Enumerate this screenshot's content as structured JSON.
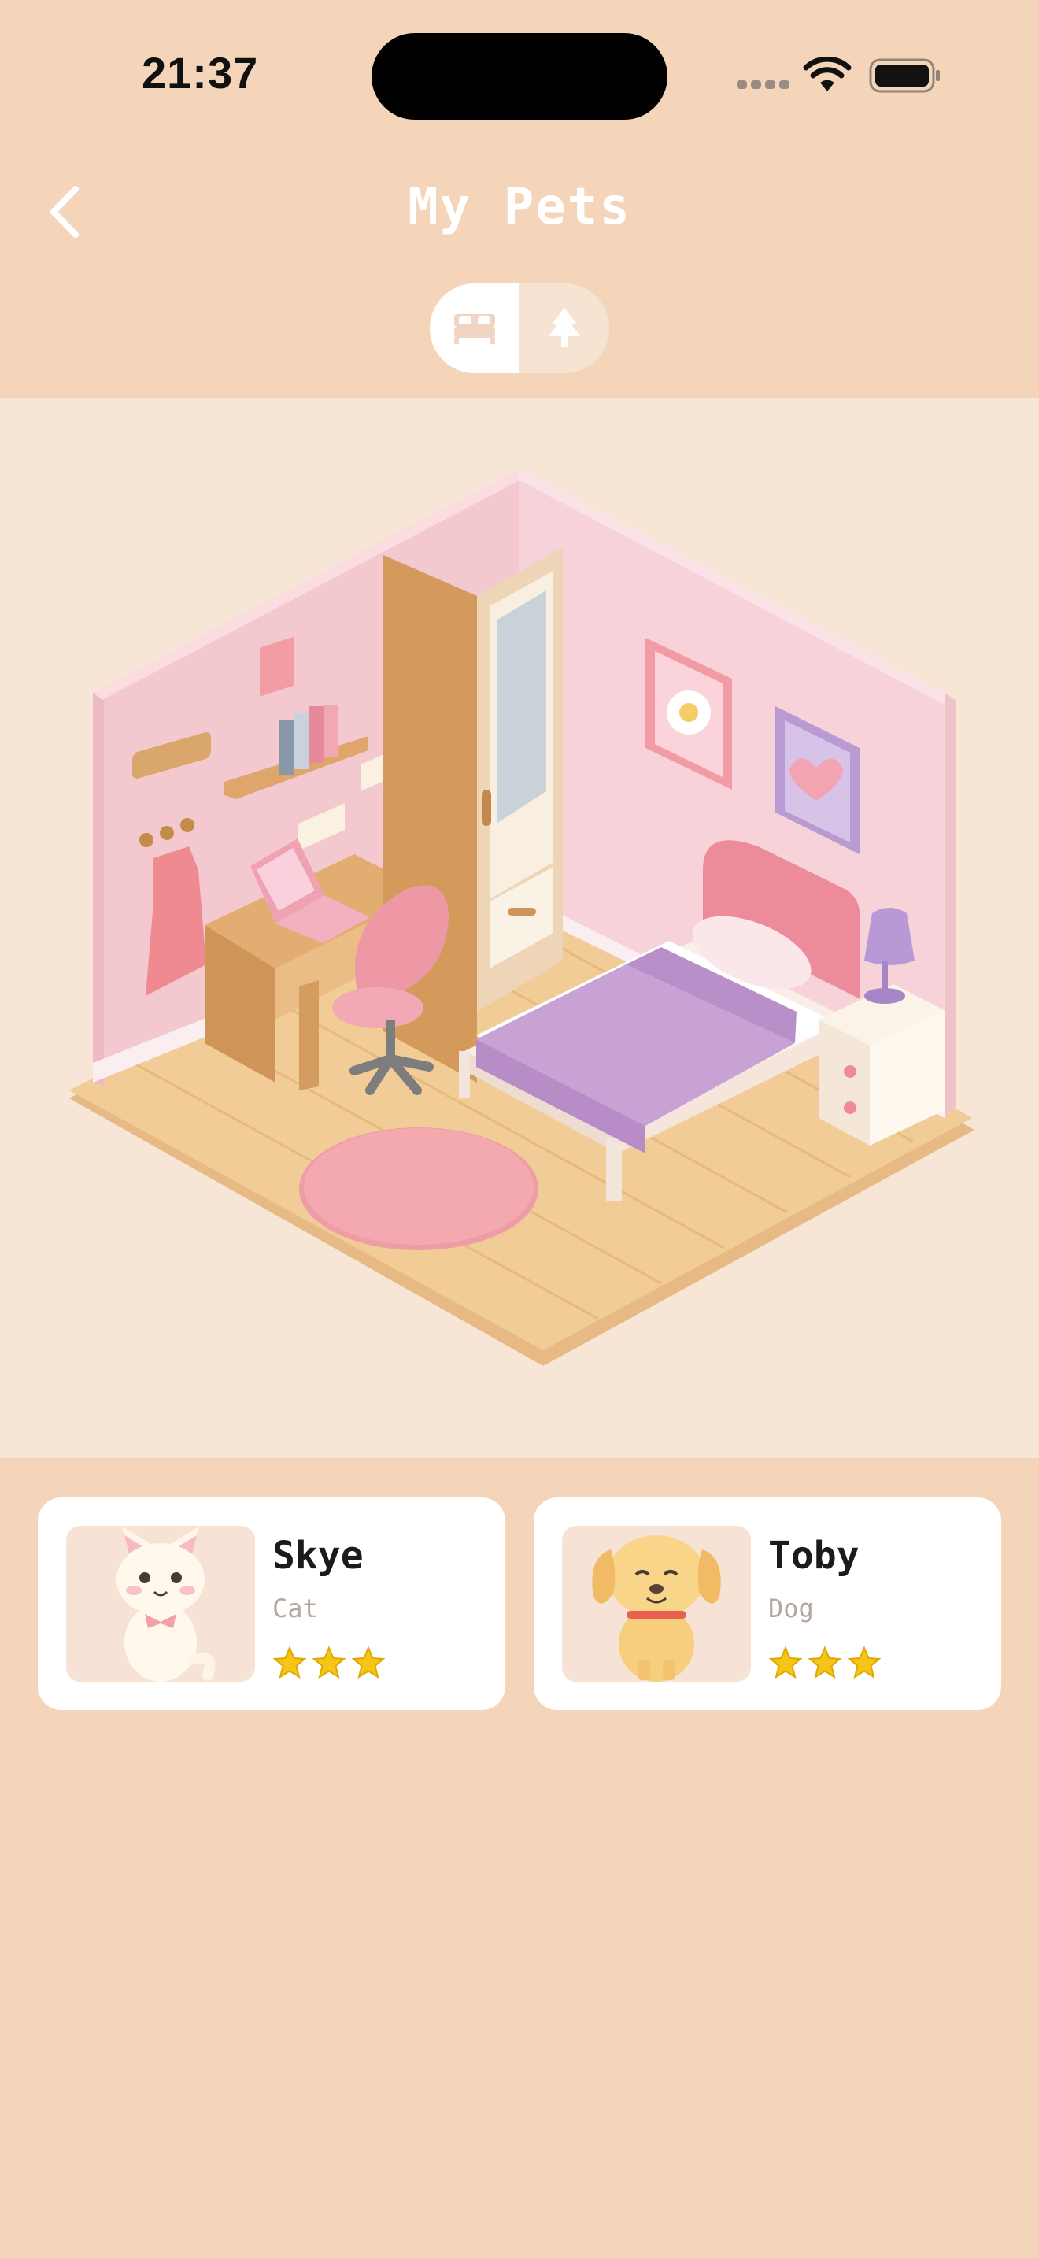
{
  "status_bar": {
    "time": "21:37"
  },
  "header": {
    "title": "My Pets"
  },
  "view_toggle": {
    "options": [
      {
        "icon": "bed-icon",
        "active": true
      },
      {
        "icon": "tree-icon",
        "active": false
      }
    ]
  },
  "pets": [
    {
      "name": "Skye",
      "species": "Cat",
      "stars": 3,
      "avatar_icon": "cat-icon"
    },
    {
      "name": "Toby",
      "species": "Dog",
      "stars": 3,
      "avatar_icon": "dog-icon"
    }
  ],
  "colors": {
    "background": "#f4d5b9",
    "room_background": "#f7e5d5",
    "card": "#ffffff",
    "star": "#f5c518"
  }
}
